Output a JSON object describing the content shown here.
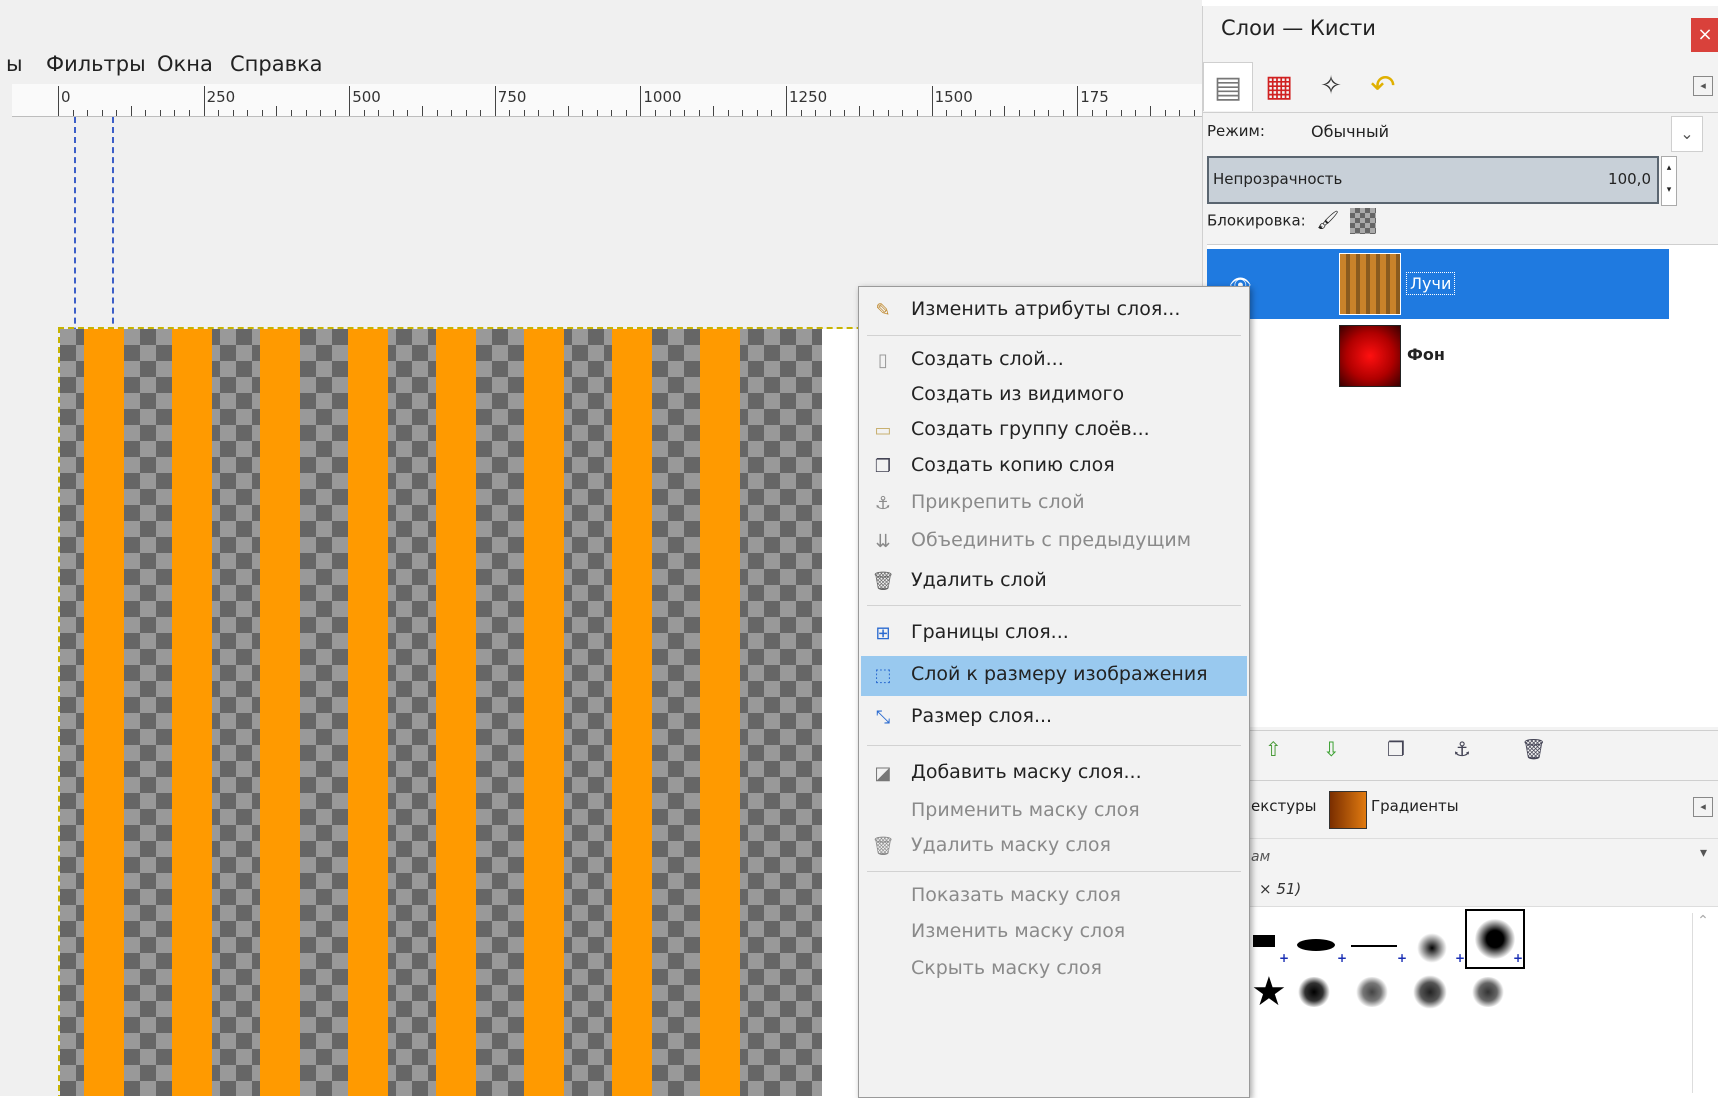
{
  "menubar": {
    "cut_item": "ы",
    "items": [
      "Фильтры",
      "Окна",
      "Справка"
    ]
  },
  "ruler": {
    "labels": [
      "0",
      "250",
      "500",
      "750",
      "1000",
      "1250",
      "1500",
      "175"
    ]
  },
  "dock": {
    "title": "Слои — Кисти",
    "close": "×",
    "mode_label": "Режим:",
    "mode_value": "Обычный",
    "opacity_label": "Непрозрачность",
    "opacity_value": "100,0",
    "lock_label": "Блокировка:",
    "layers": [
      {
        "name": "Лучи",
        "selected": true
      },
      {
        "name": "Фон",
        "selected": false
      }
    ],
    "bottom_tabs": {
      "textures": "екстуры",
      "gradients": "Градиенты"
    },
    "brush_filter": "ам",
    "brush_info": "× 51)"
  },
  "context_menu": {
    "items": [
      {
        "label": "Изменить атрибуты слоя...",
        "icon": "edit-icon",
        "disabled": false
      },
      {
        "label": "Создать слой...",
        "icon": "new-layer-icon",
        "disabled": false
      },
      {
        "label": "Создать из видимого",
        "icon": "",
        "disabled": false
      },
      {
        "label": "Создать группу слоёв...",
        "icon": "folder-icon",
        "disabled": false
      },
      {
        "label": "Создать копию слоя",
        "icon": "duplicate-icon",
        "disabled": false
      },
      {
        "label": "Прикрепить слой",
        "icon": "anchor-icon",
        "disabled": true
      },
      {
        "label": "Объединить с предыдущим",
        "icon": "merge-down-icon",
        "disabled": true
      },
      {
        "label": "Удалить слой",
        "icon": "trash-icon",
        "disabled": false
      },
      {
        "label": "Границы слоя...",
        "icon": "layer-boundary-icon",
        "disabled": false
      },
      {
        "label": "Слой к размеру изображения",
        "icon": "layer-to-image-size-icon",
        "disabled": false,
        "highlighted": true
      },
      {
        "label": "Размер слоя...",
        "icon": "scale-layer-icon",
        "disabled": false
      },
      {
        "label": "Добавить маску слоя...",
        "icon": "add-mask-icon",
        "disabled": false
      },
      {
        "label": "Применить маску слоя",
        "icon": "",
        "disabled": true
      },
      {
        "label": "Удалить маску слоя",
        "icon": "trash-icon",
        "disabled": true
      },
      {
        "label": "Показать маску слоя",
        "icon": "",
        "disabled": true
      },
      {
        "label": "Изменить маску слоя",
        "icon": "",
        "disabled": true
      },
      {
        "label": "Скрыть маску слоя",
        "icon": "",
        "disabled": true
      }
    ]
  },
  "colors": {
    "stripe": "#ff9a00",
    "selection": "#1f7ae0",
    "menu_highlight": "#99c9ef"
  }
}
